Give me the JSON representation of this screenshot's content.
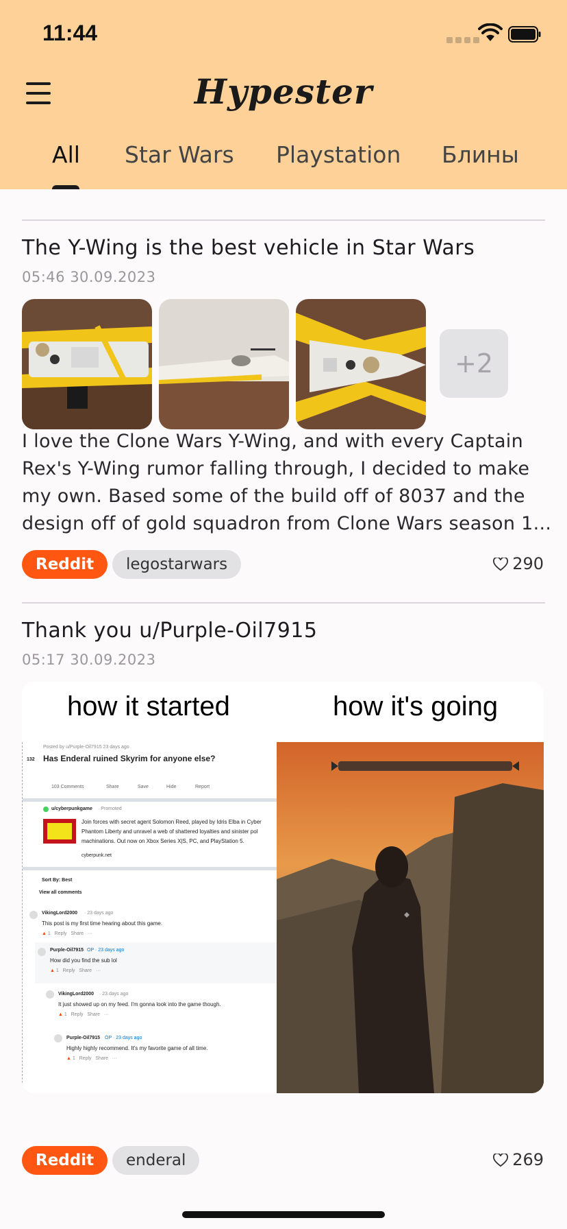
{
  "status_bar": {
    "time": "11:44"
  },
  "app": {
    "title": "Hypester",
    "menu_icon": "hamburger-menu-icon"
  },
  "tabs": [
    {
      "label": "All",
      "active": true
    },
    {
      "label": "Star Wars",
      "active": false
    },
    {
      "label": "Playstation",
      "active": false
    },
    {
      "label": "Блины",
      "active": false
    }
  ],
  "posts": [
    {
      "title": "The Y-Wing is the best vehicle in Star Wars",
      "date": "05:46 30.09.2023",
      "more_images": "+2",
      "body_lines": [
        "I love the Clone Wars Y-Wing, and with every Captain",
        "Rex's Y-Wing rumor falling through, I decided to make",
        "my own. Based some of the build off of 8037 and the",
        "design off of gold squadron from Clone Wars season 1..."
      ],
      "source": "Reddit",
      "tag": "legostarwars",
      "likes": "290"
    },
    {
      "title": "Thank you u/Purple-Oil7915",
      "date": "05:17 30.09.2023",
      "meme": {
        "caption_left": "how it started",
        "caption_right": "how it's going",
        "reddit": {
          "posted_by": "Posted by u/Purple-Oil7915 23 days ago",
          "votes": "132",
          "question": "Has Enderal ruined Skyrim for anyone else?",
          "actions": [
            "103 Comments",
            "Share",
            "Save",
            "Hide",
            "Report"
          ],
          "promo_user": "u/cyberpunkgame",
          "promo_tag": "· Promoted",
          "promo_text": [
            "Join forces with secret agent Solomon Reed, played by Idris Elba in Cyber",
            "Phantom Liberty and unravel a web of shattered loyalties and sinister pol",
            "machinations. Out now on Xbox Series X|S, PC, and PlayStation 5."
          ],
          "promo_link": "cyberpunk.net",
          "sort": "Sort By: Best",
          "view_all": "View all comments",
          "comments": [
            {
              "user": "VikingLord2000",
              "meta": "· 23 days ago",
              "text": "This post is my first time hearing about this game."
            },
            {
              "user": "Purple-Oil7915",
              "meta": "OP · 23 days ago",
              "text": "How did you find the sub lol"
            },
            {
              "user": "VikingLord2000",
              "meta": "· 23 days ago",
              "text": "It just showed up on my feed. I'm gonna look into the game though."
            },
            {
              "user": "Purple-Oil7915",
              "meta": "OP · 23 days ago",
              "text": "Highly highly recommend. It's my favorite game of all time."
            }
          ],
          "comment_actions": [
            "1",
            "Reply",
            "Share",
            "···"
          ]
        }
      },
      "source": "Reddit",
      "tag": "enderal",
      "likes": "269"
    }
  ],
  "colors": {
    "header_bg": "#fdd197",
    "reddit_chip": "#ff5611",
    "tag_chip": "#e2e1e4",
    "page_bg": "#fdfafc"
  }
}
